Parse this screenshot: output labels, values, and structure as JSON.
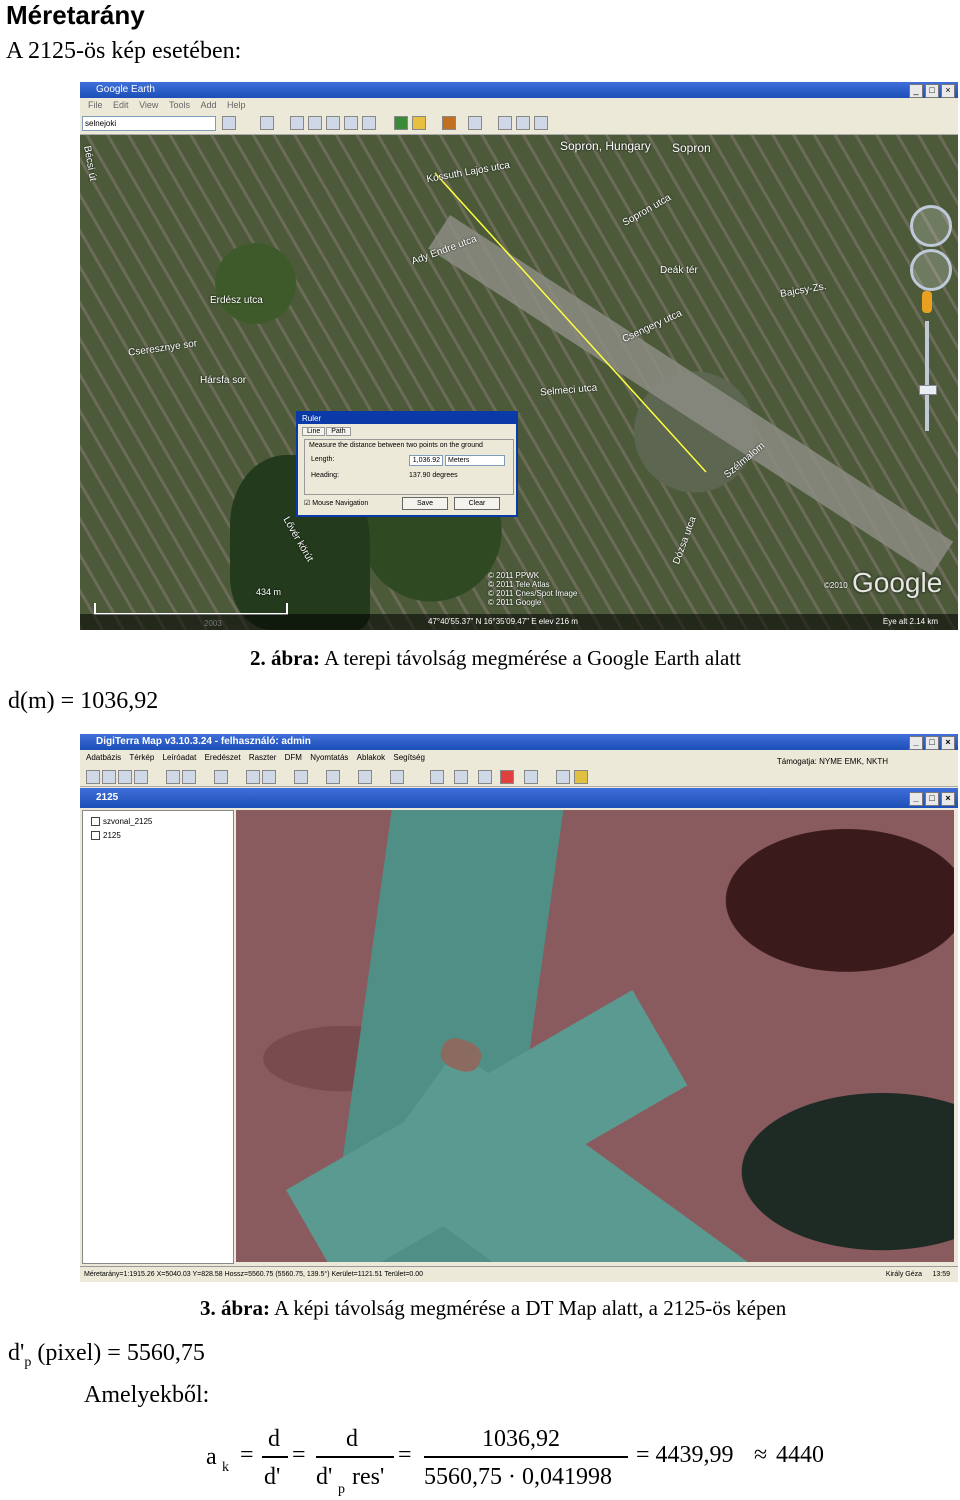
{
  "title": "Méretarány",
  "subtitle": "A 2125-ös kép esetében:",
  "d_m_label": "d(m) = 1036,92",
  "fig2": {
    "num": "2. ábra:",
    "text": " A terepi távolság megmérése a Google Earth alatt"
  },
  "fig3": {
    "num": "3. ábra:",
    "text": " A képi távolság megmérése a DT Map alatt, a 2125-ös képen"
  },
  "dp_main": "d'",
  "dp_sub": "p",
  "dp_rest": " (pixel) = 5560,75",
  "amelyekbol": "Amelyekből:",
  "google_earth": {
    "window_title": "Google Earth",
    "menu": [
      "File",
      "Edit",
      "View",
      "Tools",
      "Add",
      "Help"
    ],
    "search_value": "selnejoki",
    "streets": [
      "Bécsi út",
      "Kossuth Lajos utca",
      "Ady Endre utca",
      "Erdész utca",
      "Cseresznye sor",
      "Hársfa sor",
      "Sopron, Hungary",
      "Sopron",
      "Selmeci utca",
      "Sopron utca",
      "Deák tér",
      "Bajcsy-Zs.",
      "Csengery utca",
      "Lővér körút",
      "Szélmalom",
      "Dózsa utca"
    ],
    "ruler": {
      "title": "Ruler",
      "tab_line": "Line",
      "tab_path": "Path",
      "description": "Measure the distance between two points on the ground",
      "length_label": "Length:",
      "length_value": "1,036.92",
      "length_unit": "Meters",
      "heading_label": "Heading:",
      "heading_value": "137.90 degrees",
      "mouse_nav": "Mouse Navigation",
      "save": "Save",
      "clear": "Clear"
    },
    "copyright": [
      "© 2011 PPWK",
      "© 2011 Tele Atlas",
      "© 2011 Cnes/Spot Image",
      "© 2011 Google"
    ],
    "logo": "Google",
    "logo_year": "©2010",
    "scale_label": "434 m",
    "imagery_year": "2003",
    "status_coords": "47°40'55.37\" N   16°35'09.47\" E   elev 216 m",
    "eye_alt": "Eye alt   2.14 km"
  },
  "digiterra": {
    "window_title": "DigiTerra Map v3.10.3.24 - felhasználó: admin",
    "menu": [
      "Adatbázis",
      "Térkép",
      "Leíróadat",
      "Eredészet",
      "Raszter",
      "DFM",
      "Nyomtatás",
      "Ablakok",
      "Segítség"
    ],
    "support": "Támogatja: NYME EMK, NKTH",
    "subwindow_title": "2125",
    "layers": [
      "szvonal_2125",
      "2125"
    ],
    "status": "Méretarány=1:1915.26  X=5040.03  Y=828.58  Hossz=5560.75 (5560.75, 139.5°)  Kerület=1121.51  Terület=0.00",
    "status_user": "Király Géza",
    "status_time": "13:59"
  },
  "formula": {
    "a": "a",
    "k": "k",
    "eq": "=",
    "d": "d",
    "dprime": "d'",
    "dprime2": "d'",
    "p": "p",
    "res": "res'",
    "num3": "1036,92",
    "den3": "5560,75 · 0,041998",
    "result": "= 4439,99",
    "approx": "≈",
    "final": "4440"
  }
}
